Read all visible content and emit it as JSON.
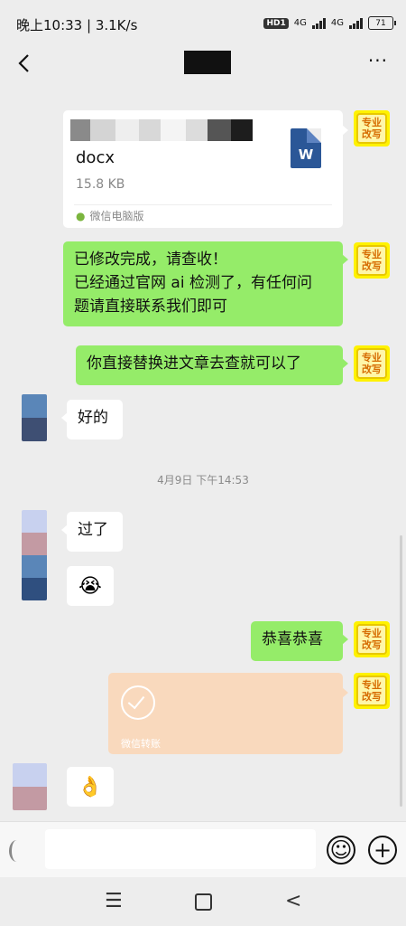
{
  "status": {
    "time": "晚上10:33",
    "speed": "3.1K/s",
    "hd": "HD1",
    "net1": "4G",
    "net2": "4G",
    "battery": "71"
  },
  "nav": {
    "back_icon": "chevron-left-icon",
    "more_label": "···"
  },
  "self_avatar": {
    "line1": "专业",
    "line2": "改写"
  },
  "file": {
    "ext": "docx",
    "size": "15.8 KB",
    "source": "微信电脑版",
    "icon_letter": "W"
  },
  "messages": {
    "m1": [
      "已修改完成，请查收！",
      "已经通过官网 ai 检测了，有任何问",
      "题请直接联系我们即可"
    ],
    "m2": "你直接替换进文章去查就可以了",
    "m3": "好的",
    "timestamp": "4月9日 下午14:53",
    "m4": "过了",
    "m5_emoji": "😭",
    "m6": "恭喜恭喜",
    "transfer_label": "微信转账",
    "m7_emoji": "👌"
  },
  "input": {
    "emoji_icon": "☺",
    "plus_icon": "+"
  },
  "sysnav": {
    "menu": "☰",
    "back": "<"
  },
  "colors": {
    "self_bubble": "#95ec69",
    "peer_bubble": "#ffffff",
    "transfer": "#f9d9bd",
    "background": "#ededed"
  }
}
